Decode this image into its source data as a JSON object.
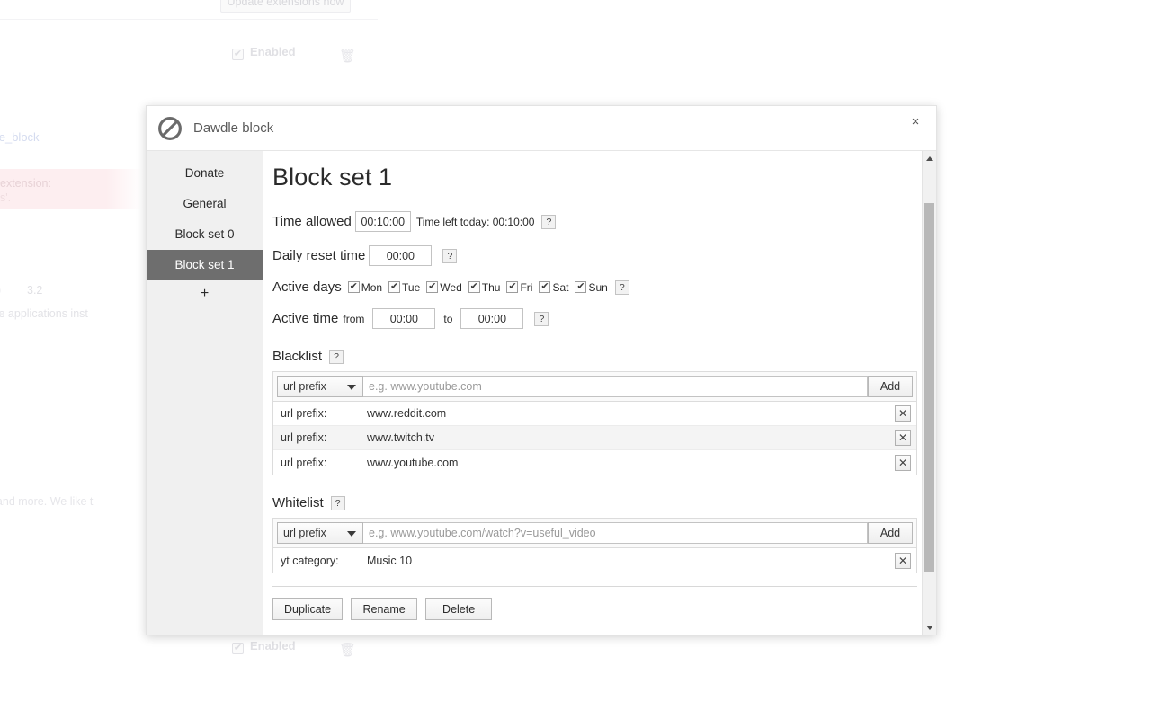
{
  "background": {
    "update_button_label": "Update extensions now",
    "enabled_label_top": "Enabled",
    "enabled_label_bottom": "Enabled",
    "link_text": "awdle_block",
    "banner_line1": "extension:",
    "banner_line2": "s'.",
    "version_paren": "e)",
    "version_number": "3.2",
    "compat_text": "compatible applications inst",
    "emotes_text": "emotes, and more. We like t",
    "trash_icon": "trash-icon",
    "check_icon": "check-icon"
  },
  "modal": {
    "brand_title": "Dawdle block",
    "brand_icon": "prohibition-icon",
    "close_icon": "close-icon",
    "close_label": "×"
  },
  "sidebar": {
    "items": [
      {
        "label": "Donate",
        "selected": false
      },
      {
        "label": "General",
        "selected": false
      },
      {
        "label": "Block set 0",
        "selected": false
      },
      {
        "label": "Block set 1",
        "selected": true
      }
    ],
    "add_label": "+",
    "add_icon": "plus-icon"
  },
  "page": {
    "title": "Block set 1",
    "help_glyph": "?",
    "time_allowed": {
      "label": "Time allowed",
      "value": "00:10:00",
      "note": "Time left today: 00:10:00"
    },
    "daily_reset": {
      "label": "Daily reset time",
      "value": "00:00"
    },
    "active_days": {
      "label": "Active days",
      "check_glyph": "✔",
      "days": [
        {
          "name": "Mon",
          "checked": true
        },
        {
          "name": "Tue",
          "checked": true
        },
        {
          "name": "Wed",
          "checked": true
        },
        {
          "name": "Thu",
          "checked": true
        },
        {
          "name": "Fri",
          "checked": true
        },
        {
          "name": "Sat",
          "checked": true
        },
        {
          "name": "Sun",
          "checked": true
        }
      ]
    },
    "active_time": {
      "label": "Active time",
      "from_label": "from",
      "from_value": "00:00",
      "to_label": "to",
      "to_value": "00:00"
    },
    "blacklist": {
      "title": "Blacklist",
      "select_value": "url prefix",
      "input_placeholder": "e.g. www.youtube.com",
      "input_value": "",
      "add_label": "Add",
      "delete_glyph": "✕",
      "entries": [
        {
          "type": "url prefix:",
          "value": "www.reddit.com"
        },
        {
          "type": "url prefix:",
          "value": "www.twitch.tv"
        },
        {
          "type": "url prefix:",
          "value": "www.youtube.com"
        }
      ]
    },
    "whitelist": {
      "title": "Whitelist",
      "select_value": "url prefix",
      "input_placeholder": "e.g. www.youtube.com/watch?v=useful_video",
      "input_value": "",
      "add_label": "Add",
      "delete_glyph": "✕",
      "entries": [
        {
          "type": "yt category:",
          "value": "Music 10"
        }
      ]
    },
    "actions": {
      "duplicate": "Duplicate",
      "rename": "Rename",
      "delete": "Delete"
    }
  },
  "colors": {
    "sidebar_bg": "#f0f0f0",
    "sidebar_selected_bg": "#6e6e6e",
    "banner_pink": "#fdeef0",
    "scrollbar_thumb": "#b8b8b8"
  }
}
